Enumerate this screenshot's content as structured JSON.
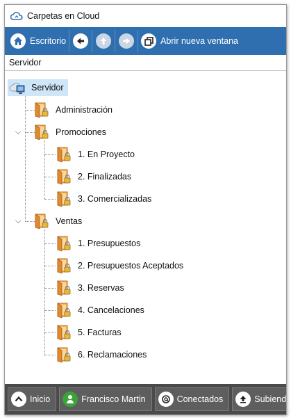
{
  "window": {
    "title": "Carpetas en Cloud"
  },
  "toolbar": {
    "desktop_label": "Escritorio",
    "new_window_label": "Abrir nueva ventana"
  },
  "breadcrumb": "Servidor",
  "tree": {
    "root": "Servidor",
    "administracion": "Administración",
    "promociones": "Promociones",
    "promociones_children": [
      "1. En Proyecto",
      "2. Finalizadas",
      "3. Comercializadas"
    ],
    "ventas": "Ventas",
    "ventas_children": [
      "1. Presupuestos",
      "2. Presupuestos Aceptados",
      "3. Reservas",
      "4. Cancelaciones",
      "5. Facturas",
      "6. Reclamaciones"
    ]
  },
  "bottombar": {
    "inicio": "Inicio",
    "user": "Francisco Martin",
    "conectados": "Conectados",
    "subiendo": "Subiendo"
  },
  "colors": {
    "toolbar": "#2f6fb0",
    "bottombar": "#4a4a4a",
    "selection": "#cfe5f8",
    "folder": "#f0a64a"
  }
}
